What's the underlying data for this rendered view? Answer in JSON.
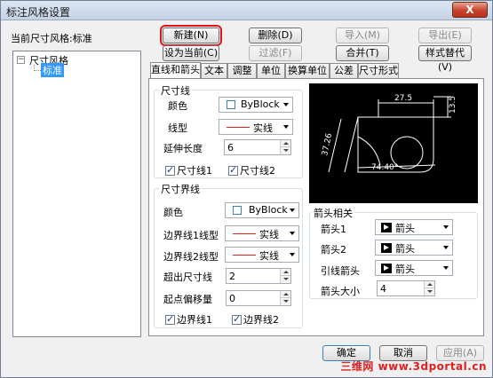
{
  "window": {
    "title": "标注风格设置",
    "close_label": "X"
  },
  "current_style": {
    "label": "当前尺寸风格:",
    "value": "标准"
  },
  "toolbar": {
    "new": "新建(N)",
    "set_current": "设为当前(C)",
    "delete": "删除(D)",
    "filter": "过滤(F)",
    "import": "导入(M)",
    "merge": "合并(T)",
    "export": "导出(E)",
    "style_replace": "样式替代(V)"
  },
  "tree": {
    "root": "尺寸风格",
    "child": "标准"
  },
  "tabs": [
    "直线和箭头",
    "文本",
    "调整",
    "单位",
    "换算单位",
    "公差",
    "尺寸形式"
  ],
  "dim_line": {
    "title": "尺寸线",
    "color_label": "颜色",
    "color_value": "ByBlock",
    "linetype_label": "线型",
    "linetype_value": "实线",
    "extend_label": "延伸长度",
    "extend_value": "6",
    "check1": "尺寸线1",
    "check2": "尺寸线2"
  },
  "ext_line": {
    "title": "尺寸界线",
    "color_label": "颜色",
    "color_value": "ByBlock",
    "lt1_label": "边界线1线型",
    "lt1_value": "实线",
    "lt2_label": "边界线2线型",
    "lt2_value": "实线",
    "beyond_label": "超出尺寸线",
    "beyond_value": "2",
    "offset_label": "起点偏移量",
    "offset_value": "0",
    "check1": "边界线1",
    "check2": "边界线2"
  },
  "arrows": {
    "title": "箭头相关",
    "arrow1_label": "箭头1",
    "arrow1_value": "箭头",
    "arrow2_label": "箭头2",
    "arrow2_value": "箭头",
    "leader_label": "引线箭头",
    "leader_value": "箭头",
    "size_label": "箭头大小",
    "size_value": "4"
  },
  "preview": {
    "dim_top": "27.5",
    "dim_right": "13.5",
    "dim_left": "37.26",
    "dim_angle": "74.40°"
  },
  "footer": {
    "ok": "确定",
    "cancel": "取消",
    "apply": "应用(A)"
  },
  "watermark": "三维网 www.3dportal.cn"
}
